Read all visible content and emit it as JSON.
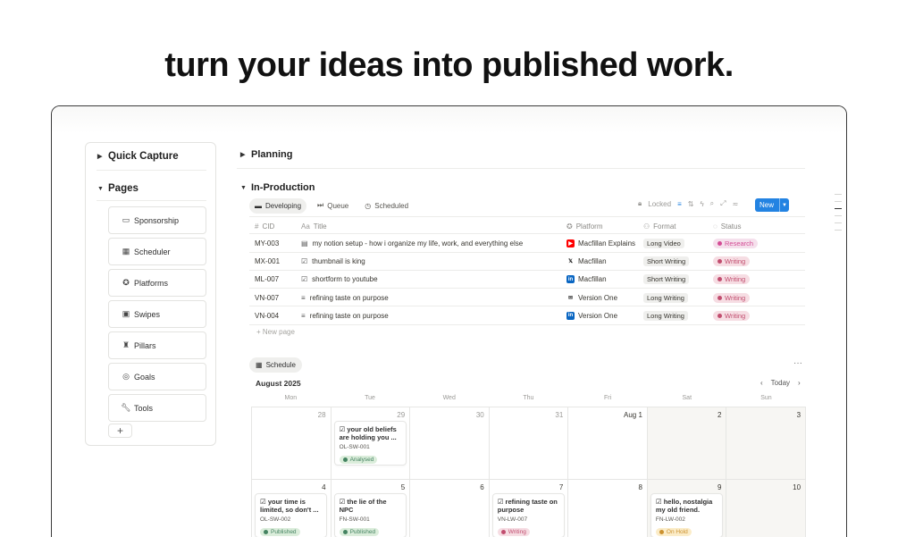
{
  "headline": "turn your ideas into published work.",
  "sidebar": {
    "quick_capture": "Quick Capture",
    "pages_heading": "Pages",
    "pages": [
      {
        "label": "Sponsorship",
        "icon": "ticket-icon"
      },
      {
        "label": "Scheduler",
        "icon": "calendar-icon"
      },
      {
        "label": "Platforms",
        "icon": "badge-check-icon"
      },
      {
        "label": "Swipes",
        "icon": "image-icon"
      },
      {
        "label": "Pillars",
        "icon": "pillar-icon"
      },
      {
        "label": "Goals",
        "icon": "target-icon"
      },
      {
        "label": "Tools",
        "icon": "wrench-icon"
      }
    ],
    "add_label": "+"
  },
  "planning": "Planning",
  "in_production": "In-Production",
  "tabs": [
    "Developing",
    "Queue",
    "Scheduled"
  ],
  "toolbar": {
    "locked": "Locked",
    "new_label": "New"
  },
  "table": {
    "headers": {
      "cid": "CID",
      "title": "Title",
      "platform": "Platform",
      "format": "Format",
      "status": "Status"
    },
    "rows": [
      {
        "cid": "MY-003",
        "title": "my notion setup - how i organize my life, work, and everything else",
        "platform": "Macfillan Explains",
        "platform_icon": "youtube-icon",
        "format": "Long Video",
        "status": "Research",
        "status_color": "#d44c95",
        "status_bg": "#f5e0ec"
      },
      {
        "cid": "MX-001",
        "title": "thumbnail is king",
        "platform": "Macfillan",
        "platform_icon": "x-icon",
        "format": "Short Writing",
        "status": "Writing",
        "status_color": "#c14d6f",
        "status_bg": "#f6dde3"
      },
      {
        "cid": "ML-007",
        "title": "shortform to youtube",
        "platform": "Macfillan",
        "platform_icon": "linkedin-icon",
        "format": "Short Writing",
        "status": "Writing",
        "status_color": "#c14d6f",
        "status_bg": "#f6dde3"
      },
      {
        "cid": "VN-007",
        "title": "refining taste on purpose",
        "platform": "Version One",
        "platform_icon": "inbox-icon",
        "format": "Long Writing",
        "status": "Writing",
        "status_color": "#c14d6f",
        "status_bg": "#f6dde3"
      },
      {
        "cid": "VN-004",
        "title": "refining taste on purpose",
        "platform": "Version One",
        "platform_icon": "linkedin-icon",
        "format": "Long Writing",
        "status": "Writing",
        "status_color": "#c14d6f",
        "status_bg": "#f6dde3"
      }
    ],
    "new_page": "+ New page"
  },
  "schedule": {
    "tab": "Schedule",
    "more": "···",
    "month": "August 2025",
    "today": "Today",
    "weekdays": [
      "Mon",
      "Tue",
      "Wed",
      "Thu",
      "Fri",
      "Sat",
      "Sun"
    ],
    "weeks": [
      [
        {
          "num": "28",
          "muted": true
        },
        {
          "num": "29",
          "muted": true,
          "card": {
            "title": "your old beliefs are holding you ...",
            "id": "OL-SW-001",
            "badge": "Analysed",
            "badge_color": "#448361",
            "badge_bg": "#dbeddb"
          }
        },
        {
          "num": "30",
          "muted": true
        },
        {
          "num": "31",
          "muted": true
        },
        {
          "num": "Aug 1"
        },
        {
          "num": "2",
          "weekend": true
        },
        {
          "num": "3",
          "weekend": true
        }
      ],
      [
        {
          "num": "4",
          "card": {
            "title": "your time is limited, so don't ...",
            "id": "OL-SW-002",
            "badge": "Published",
            "badge_color": "#448361",
            "badge_bg": "#dbeddb"
          }
        },
        {
          "num": "5",
          "card": {
            "title": "the lie of the NPC",
            "id": "FN-SW-001",
            "badge": "Published",
            "badge_color": "#448361",
            "badge_bg": "#dbeddb"
          }
        },
        {
          "num": "6"
        },
        {
          "num": "7",
          "card": {
            "title": "refining taste on purpose",
            "id": "VN-LW-007",
            "badge": "Writing",
            "badge_color": "#c14d6f",
            "badge_bg": "#f6dde3"
          }
        },
        {
          "num": "8"
        },
        {
          "num": "9",
          "weekend": true,
          "card": {
            "title": "hello, nostalgia my old friend.",
            "id": "FN-LW-002",
            "badge": "On Hold",
            "badge_color": "#cb912f",
            "badge_bg": "#fbecc8"
          }
        },
        {
          "num": "10",
          "weekend": true
        }
      ]
    ]
  },
  "colors": {
    "accent": "#2383e2",
    "youtube": "#ff0000",
    "linkedin": "#0a66c2",
    "x": "#000000"
  }
}
